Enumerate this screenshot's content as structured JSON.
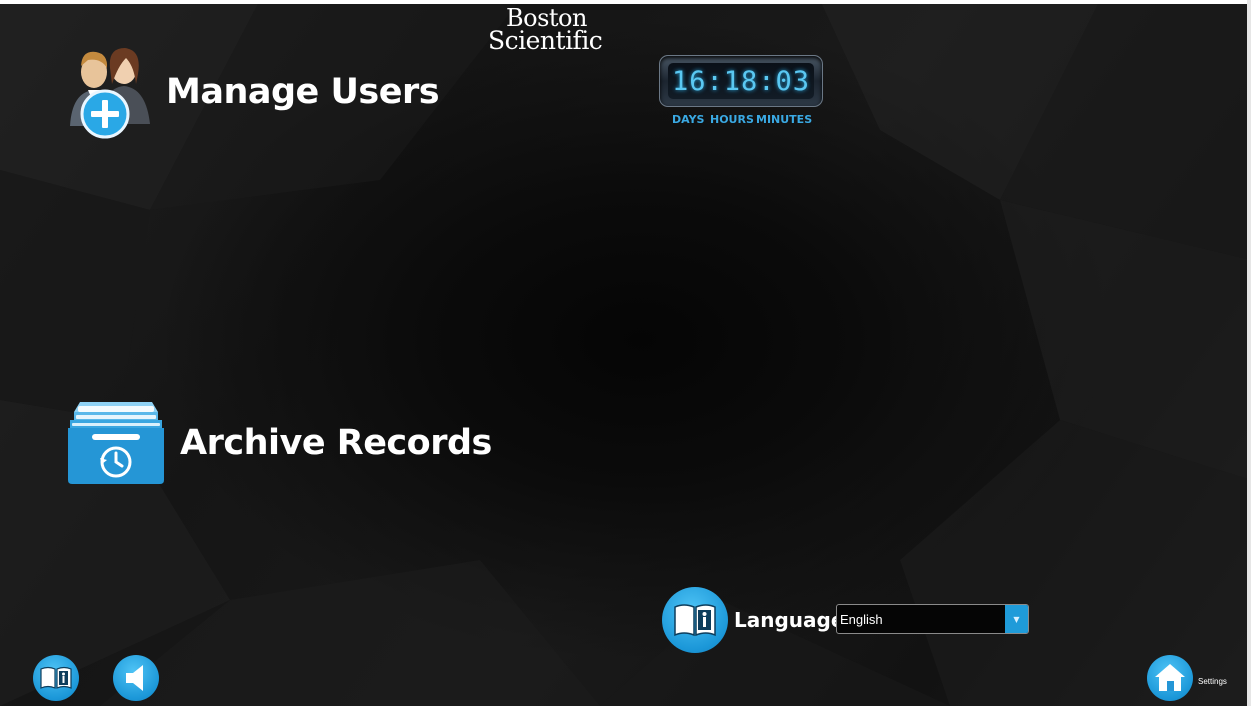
{
  "brand": {
    "line1": "Boston",
    "line2": "Scientific"
  },
  "tiles": {
    "manage_users": {
      "label": "Manage Users",
      "icon": "users-add-icon"
    },
    "archive_records": {
      "label": "Archive Records",
      "icon": "archive-drawer-icon"
    }
  },
  "timer": {
    "value": "16:18:03",
    "days": "16",
    "hours": "18",
    "minutes": "03",
    "labels": {
      "days": "DAYS",
      "hours": "HOURS",
      "minutes": "MINUTES"
    }
  },
  "language": {
    "label": "Language",
    "selected": "English",
    "icon": "manual-info-icon"
  },
  "footer": {
    "help_icon": "manual-info-icon",
    "sound_icon": "speaker-icon",
    "settings_icon": "home-icon",
    "settings_label": "Settings"
  },
  "colors": {
    "accent": "#1f9bd9",
    "timer_digits": "#5ac8f2",
    "background": "#141414"
  }
}
